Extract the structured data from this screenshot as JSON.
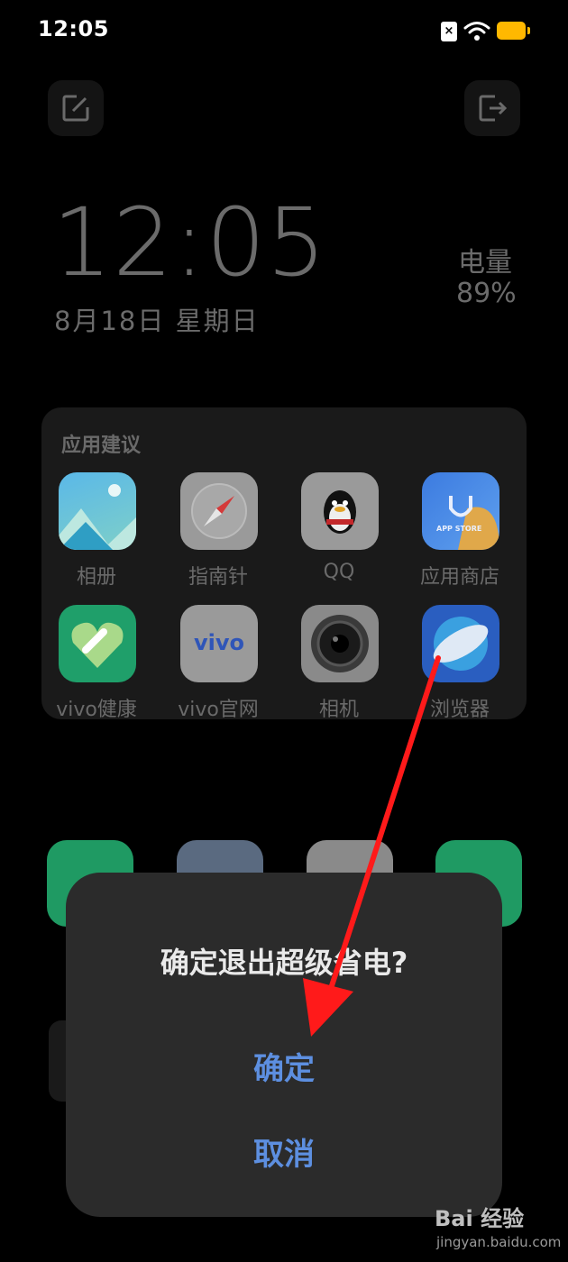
{
  "status_bar": {
    "time": "12:05",
    "sim_badge": "×"
  },
  "lock": {
    "clock": "12:05",
    "date": "8月18日  星期日",
    "battery_label": "电量",
    "battery_value": "89%"
  },
  "suggestions": {
    "title": "应用建议",
    "apps": [
      {
        "label": "相册",
        "icon": "gallery-icon"
      },
      {
        "label": "指南针",
        "icon": "compass-icon"
      },
      {
        "label": "QQ",
        "icon": "qq-icon"
      },
      {
        "label": "应用商店",
        "icon": "app-store-icon",
        "icon_text": "APP STORE"
      },
      {
        "label": "vivo健康",
        "icon": "health-icon"
      },
      {
        "label": "vivo官网",
        "icon": "vivo-icon",
        "icon_text": "vivo"
      },
      {
        "label": "相机",
        "icon": "camera-icon"
      },
      {
        "label": "浏览器",
        "icon": "browser-icon"
      }
    ]
  },
  "dialog": {
    "title": "确定退出超级省电?",
    "confirm_label": "确定",
    "cancel_label": "取消"
  },
  "watermark": {
    "brand": "Bai 经验",
    "url": "jingyan.baidu.com"
  },
  "colors": {
    "accent": "#5d8fe0",
    "battery": "#ffb800",
    "annotation_arrow": "#ff0000"
  }
}
